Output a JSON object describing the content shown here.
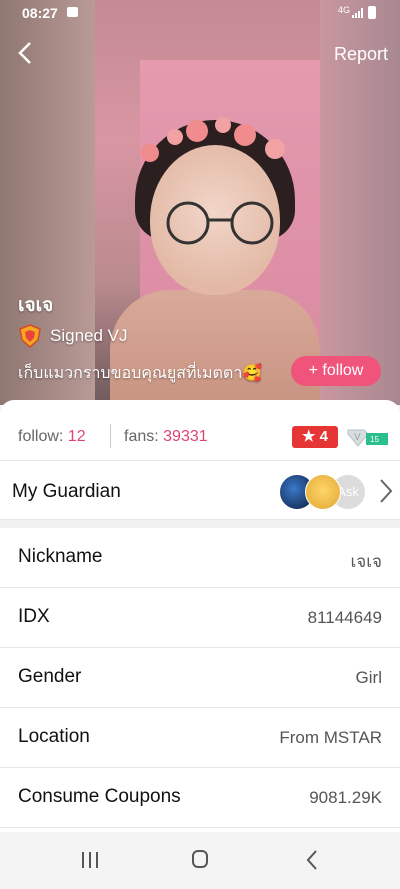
{
  "status": {
    "time": "08:27",
    "network": "4G"
  },
  "header": {
    "back_icon": "chevron-left-icon",
    "report_label": "Report"
  },
  "profile": {
    "name": "เจเจ",
    "signed_label": "Signed VJ",
    "bio": "เก็บแมวกราบขอบคุณยูสที่เมตตา🥰",
    "follow_label": "+ follow"
  },
  "stats": {
    "follow_label": "follow: ",
    "follow_value": "12",
    "fans_label": "fans: ",
    "fans_value": "39331",
    "level": "★ 4",
    "vip_label": "V",
    "vip_level": "15"
  },
  "guardian": {
    "label": "My Guardian",
    "ask_label": "Ask"
  },
  "details": [
    {
      "key": "Nickname",
      "value": "เจเจ"
    },
    {
      "key": "IDX",
      "value": "81144649"
    },
    {
      "key": "Gender",
      "value": "Girl"
    },
    {
      "key": "Location",
      "value": "From MSTAR"
    },
    {
      "key": "Consume Coupons",
      "value": "9081.29K"
    }
  ],
  "colors": {
    "accent": "#e0456f",
    "follow_button": "#f0547b",
    "level_badge": "#e53534",
    "vip_badge": "#2bbf8c"
  }
}
